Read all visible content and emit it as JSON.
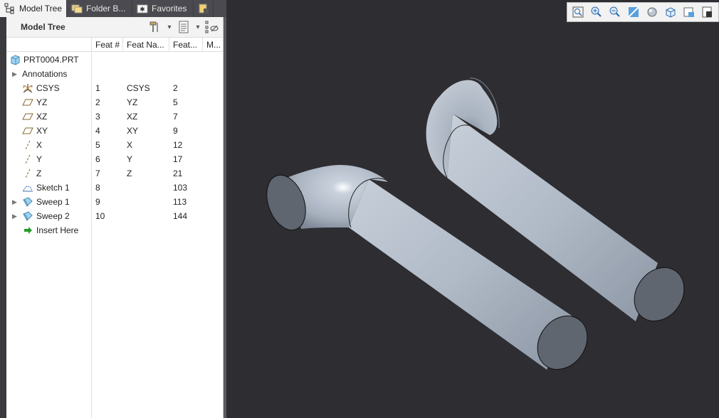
{
  "tabs": [
    {
      "label": "Model Tree",
      "active": true,
      "icon": "model-tree-icon"
    },
    {
      "label": "Folder B...",
      "active": false,
      "icon": "folder-browser-icon"
    },
    {
      "label": "Favorites",
      "active": false,
      "icon": "favorites-icon"
    },
    {
      "label": "",
      "active": false,
      "icon": "layer-tab-icon"
    }
  ],
  "panel": {
    "title": "Model Tree",
    "tools": [
      "settings-hammer-icon",
      "dropdown-icon",
      "tree-filter-icon",
      "dropdown-icon",
      "show-hide-icon"
    ]
  },
  "columns": [
    "",
    "Feat #",
    "Feat Na...",
    "Feat...",
    "M..."
  ],
  "tree": [
    {
      "label": "PRT0004.PRT",
      "icon": "part-icon",
      "expand": false,
      "feat_num": "",
      "feat_name": "",
      "feat_id": "",
      "indent": 0
    },
    {
      "label": "Annotations",
      "icon": "",
      "expand": true,
      "feat_num": "",
      "feat_name": "",
      "feat_id": "",
      "indent": 0
    },
    {
      "label": "CSYS",
      "icon": "csys-icon",
      "expand": false,
      "feat_num": "1",
      "feat_name": "CSYS",
      "feat_id": "2",
      "indent": 1
    },
    {
      "label": "YZ",
      "icon": "datum-plane-icon",
      "expand": false,
      "feat_num": "2",
      "feat_name": "YZ",
      "feat_id": "5",
      "indent": 1
    },
    {
      "label": "XZ",
      "icon": "datum-plane-icon",
      "expand": false,
      "feat_num": "3",
      "feat_name": "XZ",
      "feat_id": "7",
      "indent": 1
    },
    {
      "label": "XY",
      "icon": "datum-plane-icon",
      "expand": false,
      "feat_num": "4",
      "feat_name": "XY",
      "feat_id": "9",
      "indent": 1
    },
    {
      "label": "X",
      "icon": "datum-axis-icon",
      "expand": false,
      "feat_num": "5",
      "feat_name": "X",
      "feat_id": "12",
      "indent": 1
    },
    {
      "label": "Y",
      "icon": "datum-axis-icon",
      "expand": false,
      "feat_num": "6",
      "feat_name": "Y",
      "feat_id": "17",
      "indent": 1
    },
    {
      "label": "Z",
      "icon": "datum-axis-icon",
      "expand": false,
      "feat_num": "7",
      "feat_name": "Z",
      "feat_id": "21",
      "indent": 1
    },
    {
      "label": "Sketch 1",
      "icon": "sketch-icon",
      "expand": false,
      "feat_num": "8",
      "feat_name": "",
      "feat_id": "103",
      "indent": 1
    },
    {
      "label": "Sweep 1",
      "icon": "sweep-icon",
      "expand": true,
      "feat_num": "9",
      "feat_name": "",
      "feat_id": "113",
      "indent": 0
    },
    {
      "label": "Sweep 2",
      "icon": "sweep-icon",
      "expand": true,
      "feat_num": "10",
      "feat_name": "",
      "feat_id": "144",
      "indent": 0
    },
    {
      "label": "Insert Here",
      "icon": "insert-here-icon",
      "expand": false,
      "feat_num": "",
      "feat_name": "",
      "feat_id": "",
      "indent": 1
    }
  ],
  "view_toolbar": [
    "refit-icon",
    "zoom-in-icon",
    "zoom-out-icon",
    "repaint-icon",
    "display-style-icon",
    "saved-orientations-icon",
    "view-manager-icon",
    "datum-display-icon"
  ],
  "colors": {
    "viewport_bg": "#2d2d32",
    "pipe": "#b3bdca",
    "pipe_end": "#5f6670"
  }
}
